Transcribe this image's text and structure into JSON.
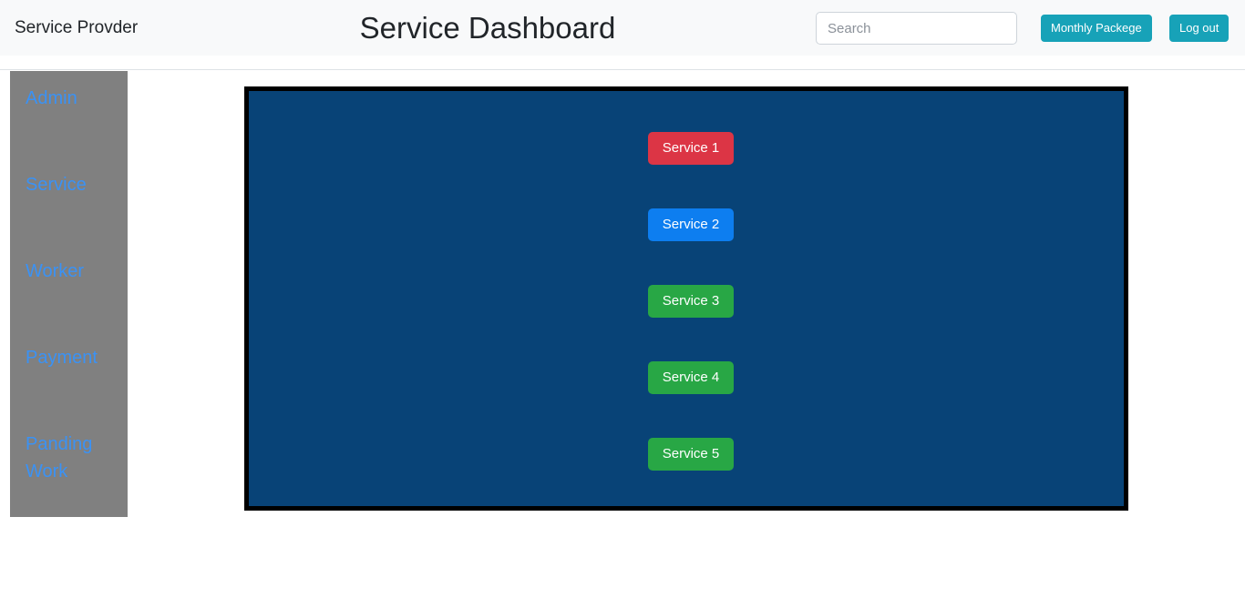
{
  "navbar": {
    "brand": "Service Provder",
    "title": "Service Dashboard",
    "search": {
      "placeholder": "Search",
      "value": ""
    },
    "buttons": [
      {
        "label": "Monthly Packege",
        "color": "#17a2b8"
      },
      {
        "label": "Log out",
        "color": "#17a2b8"
      }
    ],
    "background": "#f8f9fa"
  },
  "sidebar": {
    "background": "#808080",
    "link_color": "#3a92f5",
    "items": [
      {
        "label": "Admin"
      },
      {
        "label": "Service"
      },
      {
        "label": "Worker"
      },
      {
        "label": "Payment"
      },
      {
        "label": "Panding Work"
      }
    ]
  },
  "main": {
    "panel": {
      "background": "#084377",
      "border_color": "#000000"
    },
    "services": [
      {
        "label": "Service 1",
        "color": "#dc3545"
      },
      {
        "label": "Service 2",
        "color": "#0d7ef0"
      },
      {
        "label": "Service 3",
        "color": "#28a745"
      },
      {
        "label": "Service 4",
        "color": "#28a745"
      },
      {
        "label": "Service 5",
        "color": "#28a745"
      }
    ]
  }
}
